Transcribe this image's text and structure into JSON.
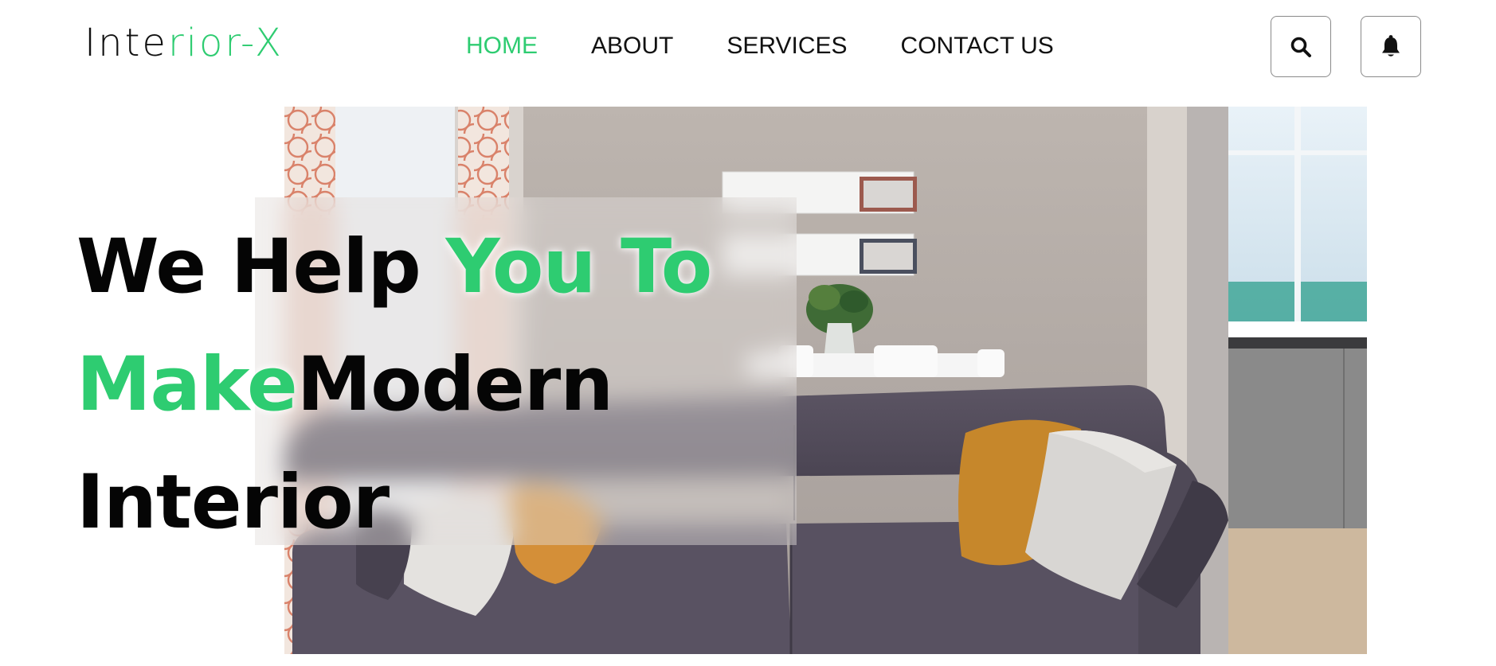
{
  "logo": {
    "part1": "Inte",
    "part2": "rior-X"
  },
  "nav": {
    "items": [
      {
        "label": "HOME",
        "active": true
      },
      {
        "label": "ABOUT",
        "active": false
      },
      {
        "label": "SERVICES",
        "active": false
      },
      {
        "label": "CONTACT US",
        "active": false
      }
    ]
  },
  "actions": {
    "search_icon": "search-icon",
    "bell_icon": "bell-icon"
  },
  "hero": {
    "line1_black": "We Help ",
    "line1_green": "You To",
    "line2_green": "Make",
    "line2_black": "Modern",
    "line3_black": "Interior"
  },
  "colors": {
    "accent": "#2ecc71",
    "text": "#111111",
    "border": "#8a8a8a"
  }
}
